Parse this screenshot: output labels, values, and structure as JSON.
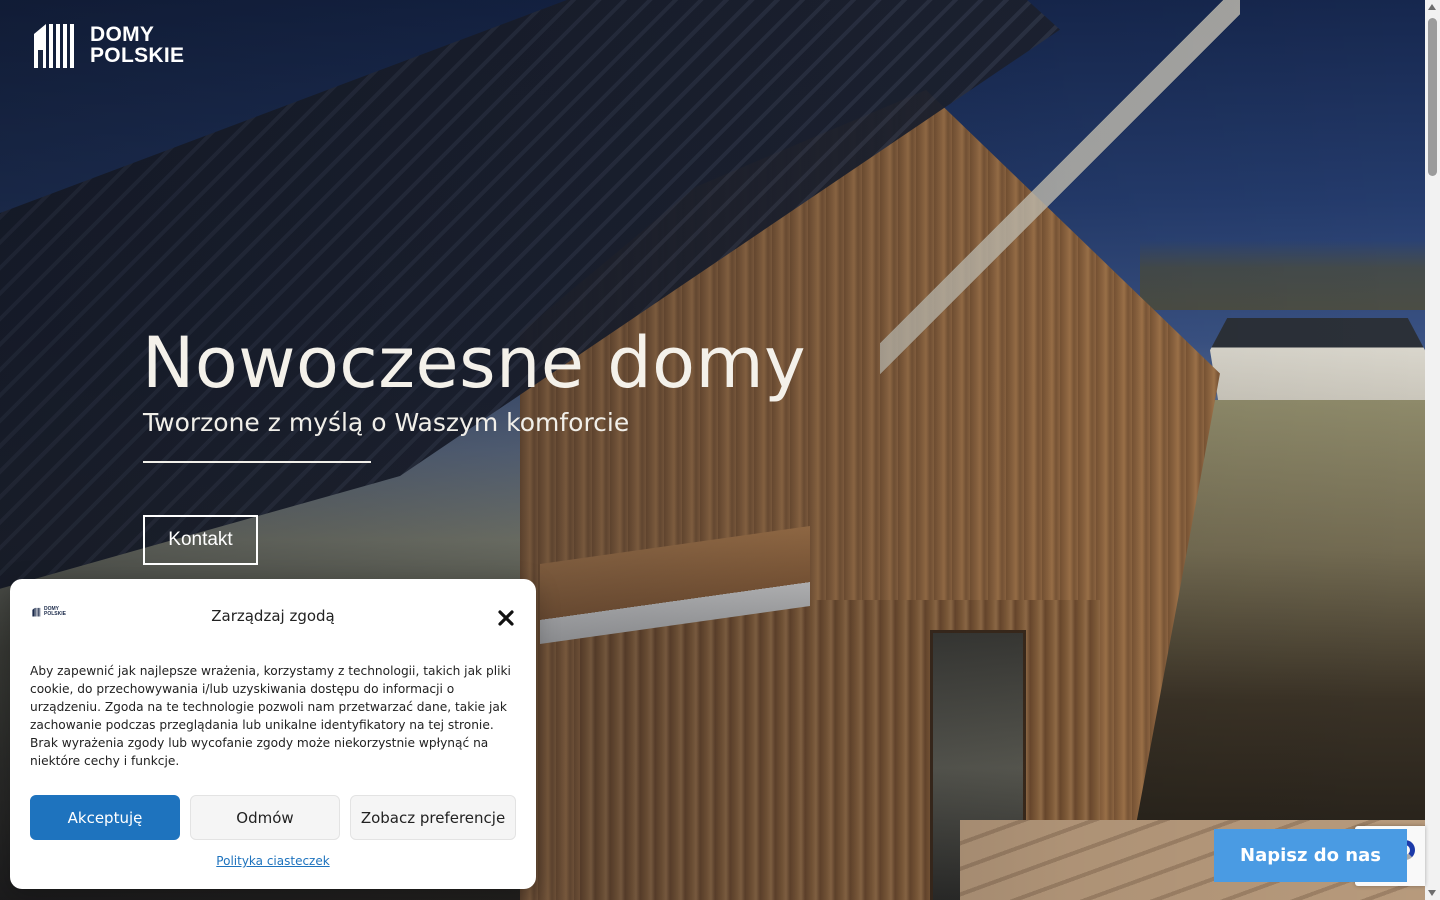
{
  "brand": {
    "name_line1": "DOMY",
    "name_line2": "POLSKIE"
  },
  "hero": {
    "title": "Nowoczesne domy",
    "subtitle": "Tworzone z myślą o Waszym komforcie",
    "contact_button": "Kontakt"
  },
  "cookie_modal": {
    "title": "Zarządzaj zgodą",
    "body": "Aby zapewnić jak najlepsze wrażenia, korzystamy z technologii, takich jak pliki cookie, do przechowywania i/lub uzyskiwania dostępu do informacji o urządzeniu. Zgoda na te technologie pozwoli nam przetwarzać dane, takie jak zachowanie podczas przeglądania lub unikalne identyfikatory na tej stronie. Brak wyrażenia zgody lub wycofanie zgody może niekorzystnie wpłynąć na niektóre cechy i funkcje.",
    "accept_label": "Akceptuję",
    "deny_label": "Odmów",
    "preferences_label": "Zobacz preferencje",
    "policy_link": "Polityka ciasteczek",
    "close_icon": "close-icon"
  },
  "chat": {
    "write_button": "Napisz do nas"
  },
  "icons": {
    "logo": "building-logo-icon",
    "close": "close-icon",
    "recaptcha": "recaptcha-icon"
  },
  "colors": {
    "accent": "#1e73be",
    "chat_button": "#4a9be3",
    "hero_text": "#f4f1ea"
  }
}
